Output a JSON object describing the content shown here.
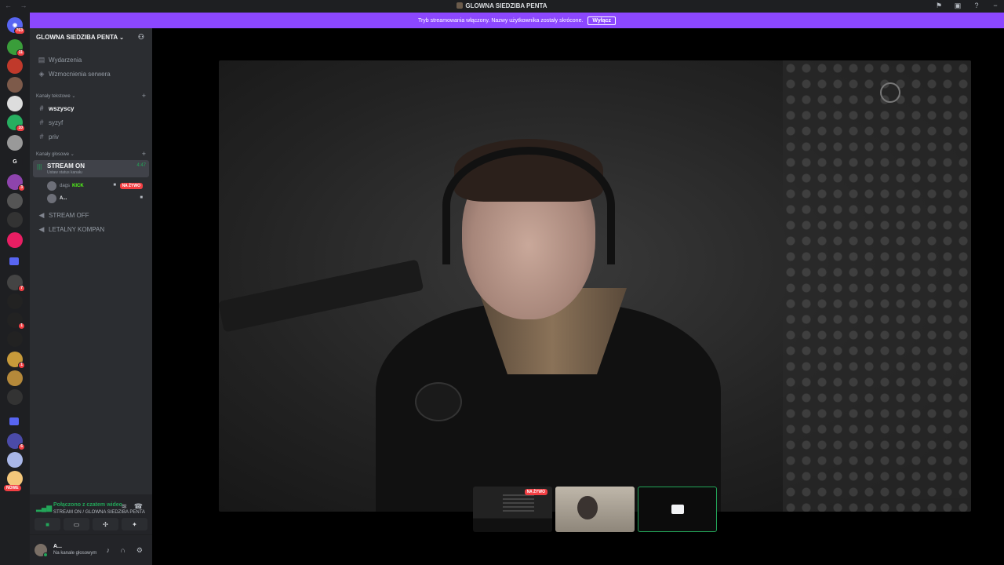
{
  "window": {
    "title": "GLOWNA SIEDZIBA PENTA",
    "nav_arrows": "← →",
    "icons": [
      "inbox-icon",
      "screen-share-icon",
      "help-icon",
      "minimize-icon"
    ]
  },
  "stream_banner": {
    "text": "Tryb streamowania włączony. Nazwy użytkownika zostały skrócone.",
    "button": "Wyłącz",
    "color": "#8c47ff"
  },
  "server_rail": {
    "home_badge": "763",
    "badges": [
      "11",
      "10",
      "3",
      "335",
      "7",
      "1",
      "1",
      "6"
    ],
    "letter_server": "G",
    "new_label": "NOWE"
  },
  "server": {
    "name": "GLOWNA SIEDZIBA PENTA",
    "items": [
      {
        "label": "Wydarzenia",
        "icon": "calendar-icon"
      },
      {
        "label": "Wzmocnienia serwera",
        "icon": "boost-icon"
      }
    ],
    "text_category": "Kanały tekstowe",
    "text_channels": [
      {
        "label": "wszyscy",
        "unread": true
      },
      {
        "label": "syzyf",
        "unread": false
      },
      {
        "label": "priv",
        "unread": false
      }
    ],
    "voice_category": "Kanały głosowe",
    "active_voice": {
      "name": "STREAM ON",
      "status": "Ustaw status kanału",
      "time": "4:47",
      "users": [
        {
          "name": "dags",
          "tag": "KICK",
          "live": "NA ŻYWO"
        },
        {
          "name": "A..."
        }
      ]
    },
    "voice_channels": [
      {
        "label": "STREAM OFF"
      },
      {
        "label": "LETALNY KOMPAN"
      }
    ]
  },
  "voice_panel": {
    "connected": "Połączono z czatem wideo",
    "location": "STREAM ON / GLOWNA SIEDZIBA PENTA"
  },
  "user_panel": {
    "name": "A...",
    "status": "Na kanale głosowym"
  },
  "stage": {
    "thumbnails": [
      {
        "type": "screen",
        "live": "NA ŻYWO"
      },
      {
        "type": "person"
      },
      {
        "type": "self"
      }
    ]
  }
}
